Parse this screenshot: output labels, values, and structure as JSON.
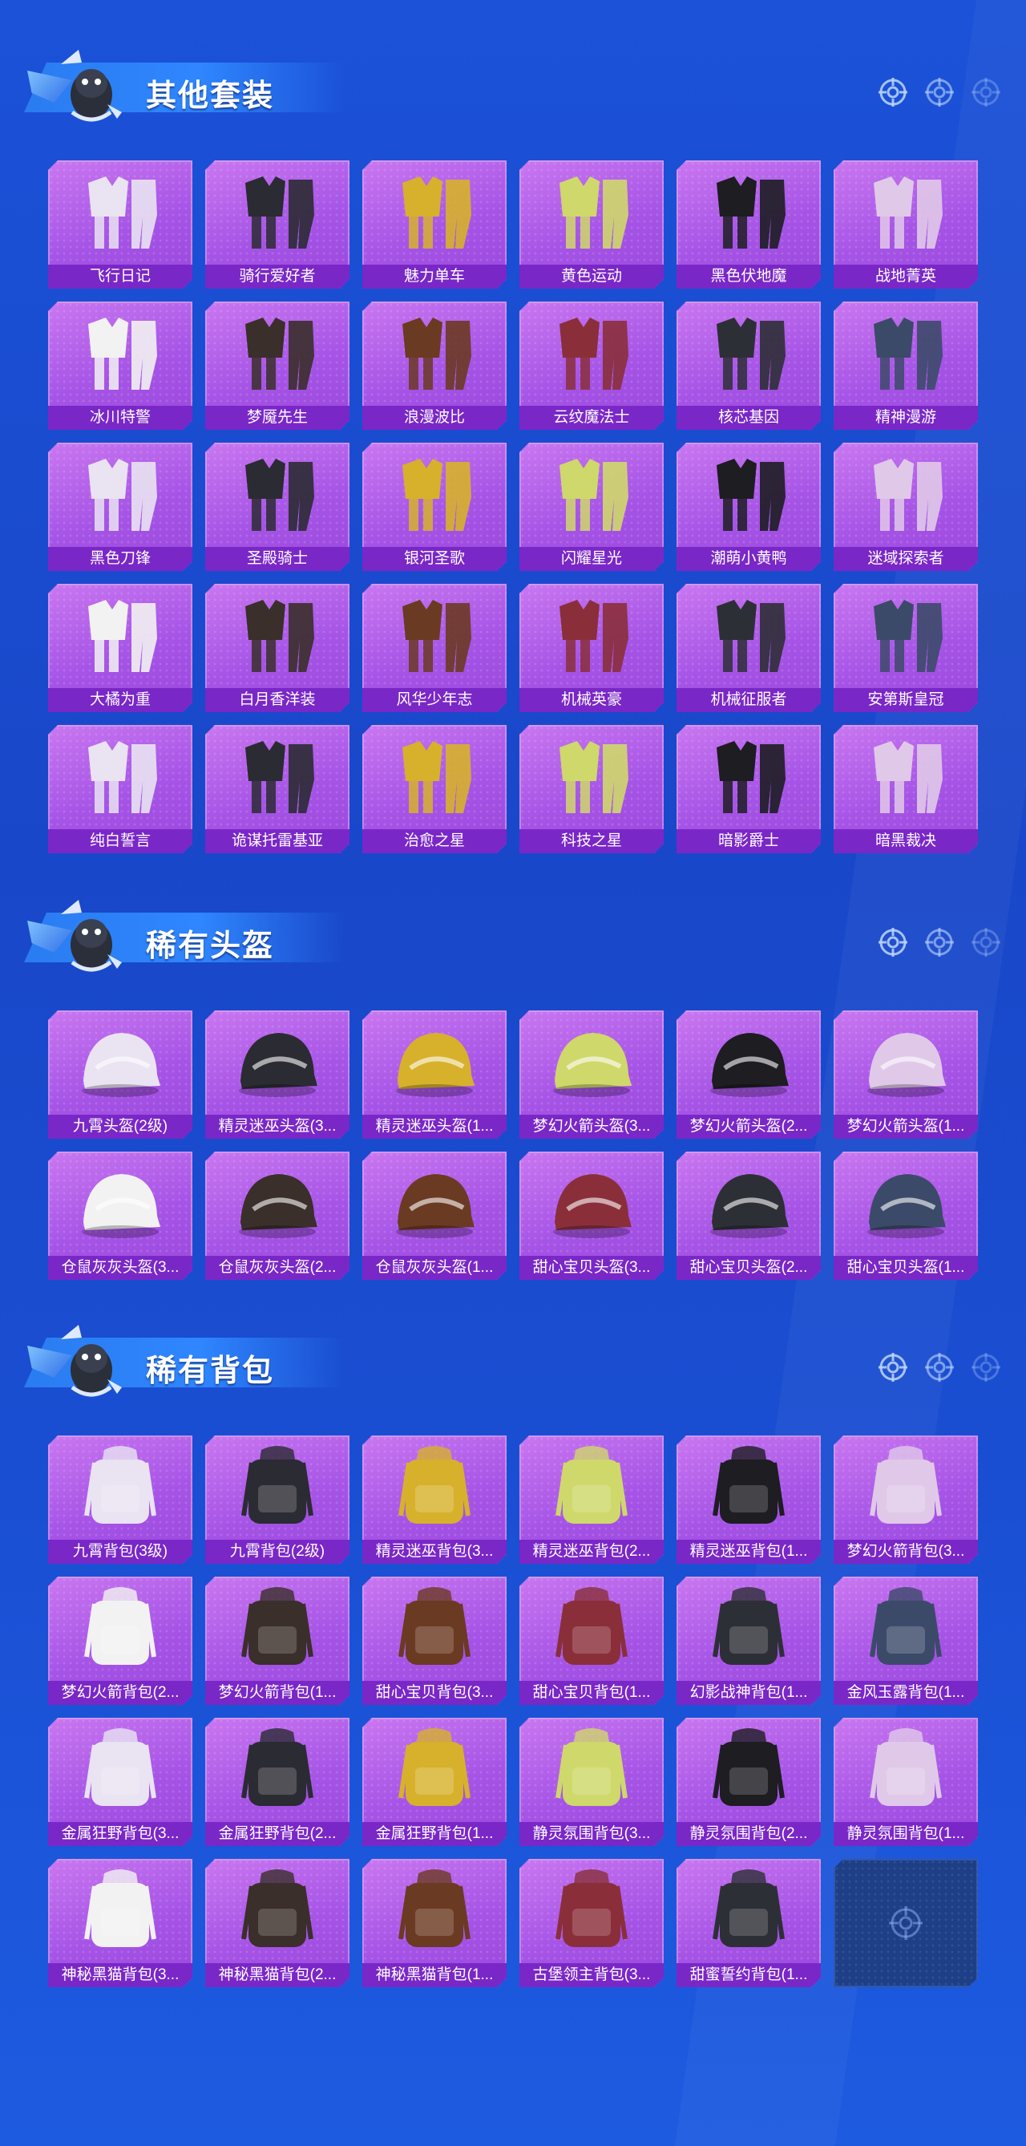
{
  "colors": {
    "background": "#1a4fd3",
    "card": "#a654e6",
    "label_bar": "#7a27c8",
    "empty_card": "#1e3f86"
  },
  "sections": [
    {
      "title": "其他套装",
      "items": [
        "飞行日记",
        "骑行爱好者",
        "魅力单车",
        "黄色运动",
        "黑色伏地魔",
        "战地菁英",
        "冰川特警",
        "梦魇先生",
        "浪漫波比",
        "云纹魔法士",
        "核芯基因",
        "精神漫游",
        "黑色刀锋",
        "圣殿骑士",
        "银河圣歌",
        "闪耀星光",
        "潮萌小黄鸭",
        "迷域探索者",
        "大橘为重",
        "白月香洋装",
        "风华少年志",
        "机械英豪",
        "机械征服者",
        "安第斯皇冠",
        "纯白誓言",
        "诡谋托雷基亚",
        "治愈之星",
        "科技之星",
        "暗影爵士",
        "暗黑裁决"
      ]
    },
    {
      "title": "稀有头盔",
      "items": [
        "九霄头盔(2级)",
        "精灵迷巫头盔(3...",
        "精灵迷巫头盔(1...",
        "梦幻火箭头盔(3...",
        "梦幻火箭头盔(2...",
        "梦幻火箭头盔(1...",
        "仓鼠灰灰头盔(3...",
        "仓鼠灰灰头盔(2...",
        "仓鼠灰灰头盔(1...",
        "甜心宝贝头盔(3...",
        "甜心宝贝头盔(2...",
        "甜心宝贝头盔(1..."
      ]
    },
    {
      "title": "稀有背包",
      "items": [
        "九霄背包(3级)",
        "九霄背包(2级)",
        "精灵迷巫背包(3...",
        "精灵迷巫背包(2...",
        "精灵迷巫背包(1...",
        "梦幻火箭背包(3...",
        "梦幻火箭背包(2...",
        "梦幻火箭背包(1...",
        "甜心宝贝背包(3...",
        "甜心宝贝背包(1...",
        "幻影战神背包(1...",
        "金风玉露背包(1...",
        "金属狂野背包(3...",
        "金属狂野背包(2...",
        "金属狂野背包(1...",
        "静灵氛围背包(3...",
        "静灵氛围背包(2...",
        "静灵氛围背包(1...",
        "神秘黑猫背包(3...",
        "神秘黑猫背包(2...",
        "神秘黑猫背包(1...",
        "古堡领主背包(3...",
        "甜蜜誓约背包(1..."
      ]
    }
  ]
}
